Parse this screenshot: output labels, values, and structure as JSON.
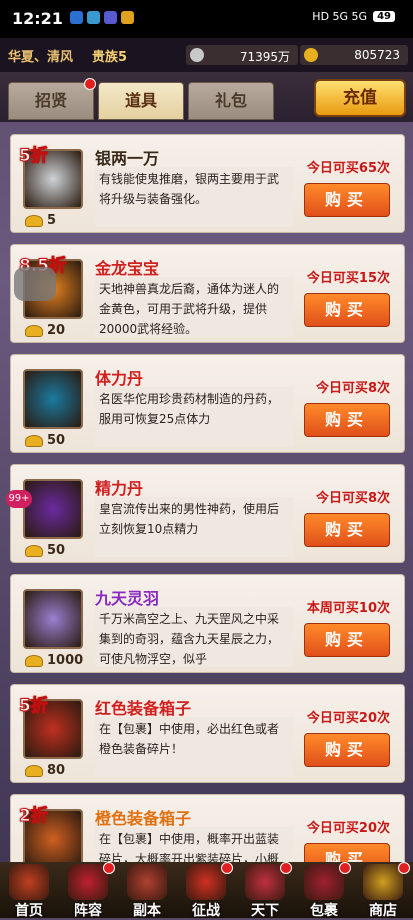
{
  "status": {
    "time": "12:21",
    "network": "HD 5G 5G",
    "battery": "49"
  },
  "header": {
    "server": "华夏、清风",
    "vip": "贵族5",
    "silver": "71395万",
    "gold": "805723"
  },
  "tabs": [
    {
      "label": "招贤",
      "dot": true
    },
    {
      "label": "道具",
      "active": true
    },
    {
      "label": "礼包"
    }
  ],
  "recharge_label": "充值",
  "items": [
    {
      "name": "银两一万",
      "name_color": "#3a2a1a",
      "discount": "5折",
      "price": "5",
      "desc": "有钱能使鬼推磨，银两主要用于武将升级与装备强化。",
      "limit": "今日可买65次",
      "buy": "购买",
      "thumb_color": "#cfd4d8"
    },
    {
      "name": "金龙宝宝",
      "name_color": "#d02020",
      "discount": "8.5折",
      "price": "20",
      "desc": "天地神兽真龙后裔，通体为迷人的金黄色，可用于武将升级，提供20000武将经验。",
      "limit": "今日可买15次",
      "buy": "购买",
      "thumb_color": "#e08020"
    },
    {
      "name": "体力丹",
      "name_color": "#d02020",
      "discount": "",
      "price": "50",
      "desc": "名医华佗用珍贵药材制造的丹药，服用可恢复25点体力",
      "limit": "今日可买8次",
      "buy": "购买",
      "thumb_color": "#1a7aa0"
    },
    {
      "name": "精力丹",
      "name_color": "#d02020",
      "discount": "",
      "price": "50",
      "desc": "皇宫流传出来的男性神药，使用后立刻恢复10点精力",
      "limit": "今日可买8次",
      "buy": "购买",
      "thumb_color": "#6a2aa0"
    },
    {
      "name": "九天灵羽",
      "name_color": "#8a2ac0",
      "discount": "",
      "price": "1000",
      "desc": "千万米高空之上、九天罡风之中采集到的奇羽，蕴含九天星辰之力，可使凡物浮空，似乎",
      "limit": "本周可买10次",
      "buy": "购买",
      "thumb_color": "#9a80d0"
    },
    {
      "name": "红色装备箱子",
      "name_color": "#d02020",
      "discount": "5折",
      "price": "80",
      "desc": "在【包裹】中使用，必出红色或者橙色装备碎片！",
      "limit": "今日可买20次",
      "buy": "购买",
      "thumb_color": "#c03020"
    },
    {
      "name": "橙色装备箱子",
      "name_color": "#e07010",
      "discount": "2折",
      "price": "",
      "desc": "在【包裹】中使用，概率开出蓝装碎片，大概率开出紫装碎片，小概率开出橙装碎片",
      "limit": "今日可买20次",
      "buy": "购买",
      "thumb_color": "#d06020"
    }
  ],
  "nav": [
    {
      "label": "首页",
      "color": "#c04020",
      "dot": false
    },
    {
      "label": "阵容",
      "color": "#c02030",
      "dot": true
    },
    {
      "label": "副本",
      "color": "#b04030",
      "dot": false
    },
    {
      "label": "征战",
      "color": "#d03020",
      "dot": true
    },
    {
      "label": "天下",
      "color": "#c03040",
      "dot": true
    },
    {
      "label": "包裹",
      "color": "#a02030",
      "dot": true
    },
    {
      "label": "商店",
      "color": "#d0a020",
      "dot": true
    }
  ],
  "float_badge": "99+"
}
